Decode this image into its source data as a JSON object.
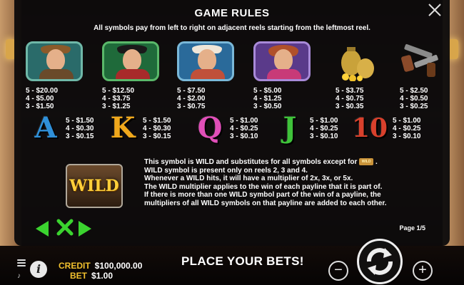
{
  "dialog": {
    "title": "GAME RULES",
    "subtitle": "All symbols pay from left to right on adjacent reels starting from the leftmost reel.",
    "page": "Page 1/5"
  },
  "symbols": [
    {
      "name": "cowboy-brown",
      "pays": [
        "5 - $20.00",
        "4 - $5.00",
        "3 - $1.50"
      ]
    },
    {
      "name": "cowboy-black",
      "pays": [
        "5 - $12.50",
        "4 - $3.75",
        "3 - $1.25"
      ]
    },
    {
      "name": "cowgirl-blonde",
      "pays": [
        "5 - $7.50",
        "4 - $2.00",
        "3 - $0.75"
      ]
    },
    {
      "name": "cowgirl-redhead",
      "pays": [
        "5 - $5.00",
        "4 - $1.25",
        "3 - $0.50"
      ]
    },
    {
      "name": "gold-bags",
      "pays": [
        "5 - $3.75",
        "4 - $0.75",
        "3 - $0.35"
      ]
    },
    {
      "name": "guns",
      "pays": [
        "5 - $2.50",
        "4 - $0.50",
        "3 - $0.25"
      ]
    }
  ],
  "cards": [
    {
      "letter": "A",
      "color": "#2f8fd8",
      "pays": [
        "5 - $1.50",
        "4 - $0.30",
        "3 - $0.15"
      ]
    },
    {
      "letter": "K",
      "color": "#f0a81c",
      "pays": [
        "5 - $1.50",
        "4 - $0.30",
        "3 - $0.15"
      ]
    },
    {
      "letter": "Q",
      "color": "#e04fb8",
      "pays": [
        "5 - $1.00",
        "4 - $0.25",
        "3 - $0.10"
      ]
    },
    {
      "letter": "J",
      "color": "#3fc23a",
      "pays": [
        "5 - $1.00",
        "4 - $0.25",
        "3 - $0.10"
      ]
    },
    {
      "letter": "10",
      "color": "#d8402c",
      "pays": [
        "5 - $1.00",
        "4 - $0.25",
        "3 - $0.10"
      ]
    }
  ],
  "wild": {
    "label": "WILD",
    "mini_label": "WILD",
    "line1_a": "This symbol is WILD and substitutes for all symbols except for",
    "line1_b": ".",
    "line2": "WILD symbol is present only on reels 2, 3 and 4.",
    "line3": "Whenever a WILD hits, it will have a multiplier of 2x, 3x, or 5x.",
    "line4": "The WILD multiplier applies to the win of each payline that it is part of.",
    "line5": "If there is more than one WILD symbol part of the win of a payline, the",
    "line6": "multipliers of all WILD symbols on that payline are added to each other."
  },
  "bottom": {
    "credit_label": "CREDIT",
    "credit_value": "$100,000.00",
    "bet_label": "BET",
    "bet_value": "$1.00",
    "message": "PLACE YOUR BETS!",
    "minus": "−",
    "plus": "+",
    "info": "i"
  },
  "colors": {
    "accent_gold": "#f2c12e",
    "nav_green": "#3bd32f"
  }
}
